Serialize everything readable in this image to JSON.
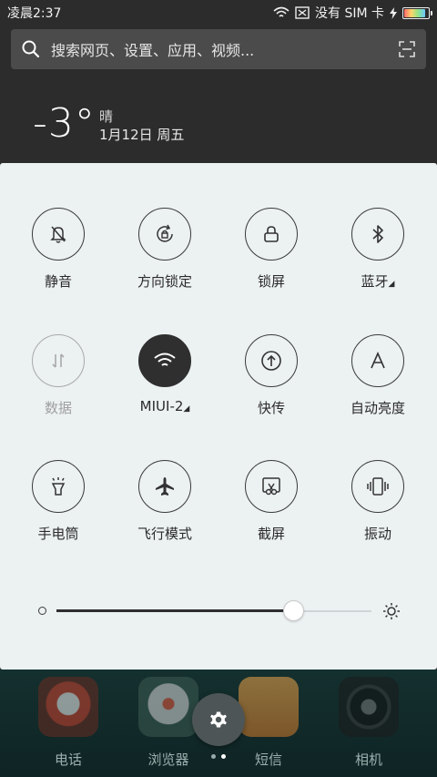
{
  "statusbar": {
    "time": "凌晨2:37",
    "carrier": "没有 SIM 卡"
  },
  "search": {
    "placeholder": "搜索网页、设置、应用、视频..."
  },
  "weather": {
    "temperature": "-3°",
    "condition": "晴",
    "date": "1月12日 周五"
  },
  "toggles": [
    {
      "label": "静音",
      "state": "off",
      "icon": "bell-off-icon"
    },
    {
      "label": "方向锁定",
      "state": "off",
      "icon": "rotation-lock-icon"
    },
    {
      "label": "锁屏",
      "state": "off",
      "icon": "lock-icon"
    },
    {
      "label": "蓝牙",
      "state": "off",
      "icon": "bluetooth-icon"
    },
    {
      "label": "数据",
      "state": "disabled",
      "icon": "data-arrows-icon"
    },
    {
      "label": "MIUI-2",
      "state": "on",
      "icon": "wifi-icon"
    },
    {
      "label": "快传",
      "state": "off",
      "icon": "upload-icon"
    },
    {
      "label": "自动亮度",
      "state": "off",
      "icon": "auto-brightness-icon"
    },
    {
      "label": "手电筒",
      "state": "off",
      "icon": "flashlight-icon"
    },
    {
      "label": "飞行模式",
      "state": "off",
      "icon": "airplane-icon"
    },
    {
      "label": "截屏",
      "state": "off",
      "icon": "screenshot-icon"
    },
    {
      "label": "振动",
      "state": "off",
      "icon": "vibrate-icon"
    }
  ],
  "brightness": {
    "level": 0.75
  },
  "dock": [
    {
      "name": "电话"
    },
    {
      "name": "浏览器"
    },
    {
      "name": "短信"
    },
    {
      "name": "相机"
    }
  ],
  "colors": {
    "panel_bg": "#ecf1f2",
    "active_toggle": "#2f2f2f"
  }
}
